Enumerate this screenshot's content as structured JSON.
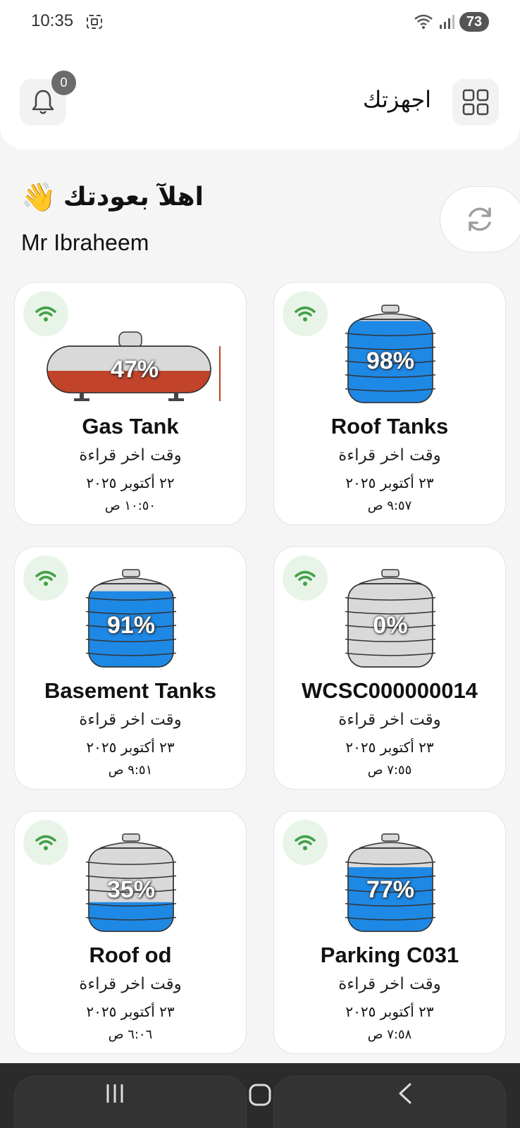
{
  "status_bar": {
    "time": "10:35",
    "battery": "73"
  },
  "header": {
    "title": "اجهزتك",
    "notifications_count": "0"
  },
  "welcome": {
    "greeting": "اهلآ بعودتك",
    "wave": "👋",
    "user_name": "Mr Ibraheem"
  },
  "devices": [
    {
      "name": "Gas Tank",
      "type": "gas",
      "level_percent": 47,
      "level_text": "47%",
      "last_reading_label": "وقت اخر قراءة",
      "date": "٢٢ أكتوبر ٢٠٢٥",
      "time": "١٠:٥٠ ص",
      "connected": true
    },
    {
      "name": "Roof Tanks",
      "type": "water",
      "level_percent": 98,
      "level_text": "98%",
      "last_reading_label": "وقت اخر قراءة",
      "date": "٢٣ أكتوبر ٢٠٢٥",
      "time": "٩:٥٧ ص",
      "connected": true
    },
    {
      "name": "Basement Tanks",
      "type": "water",
      "level_percent": 91,
      "level_text": "91%",
      "last_reading_label": "وقت اخر قراءة",
      "date": "٢٣ أكتوبر ٢٠٢٥",
      "time": "٩:٥١ ص",
      "connected": true
    },
    {
      "name": "WCSC000000014",
      "type": "water",
      "level_percent": 0,
      "level_text": "0%",
      "last_reading_label": "وقت اخر قراءة",
      "date": "٢٣ أكتوبر ٢٠٢٥",
      "time": "٧:٥٥ ص",
      "connected": true
    },
    {
      "name": "Roof od",
      "type": "water",
      "level_percent": 35,
      "level_text": "35%",
      "last_reading_label": "وقت اخر قراءة",
      "date": "٢٣ أكتوبر ٢٠٢٥",
      "time": "٦:٠٦ ص",
      "connected": true
    },
    {
      "name": "Parking C031",
      "type": "water",
      "level_percent": 77,
      "level_text": "77%",
      "last_reading_label": "وقت اخر قراءة",
      "date": "٢٣ أكتوبر ٢٠٢٥",
      "time": "٧:٥٨ ص",
      "connected": true
    }
  ],
  "colors": {
    "water": "#1e88e5",
    "gas": "#c0432a",
    "empty_tank": "#d9d9d9",
    "wifi_green": "#43a047",
    "wifi_bg": "#e8f4e8"
  }
}
